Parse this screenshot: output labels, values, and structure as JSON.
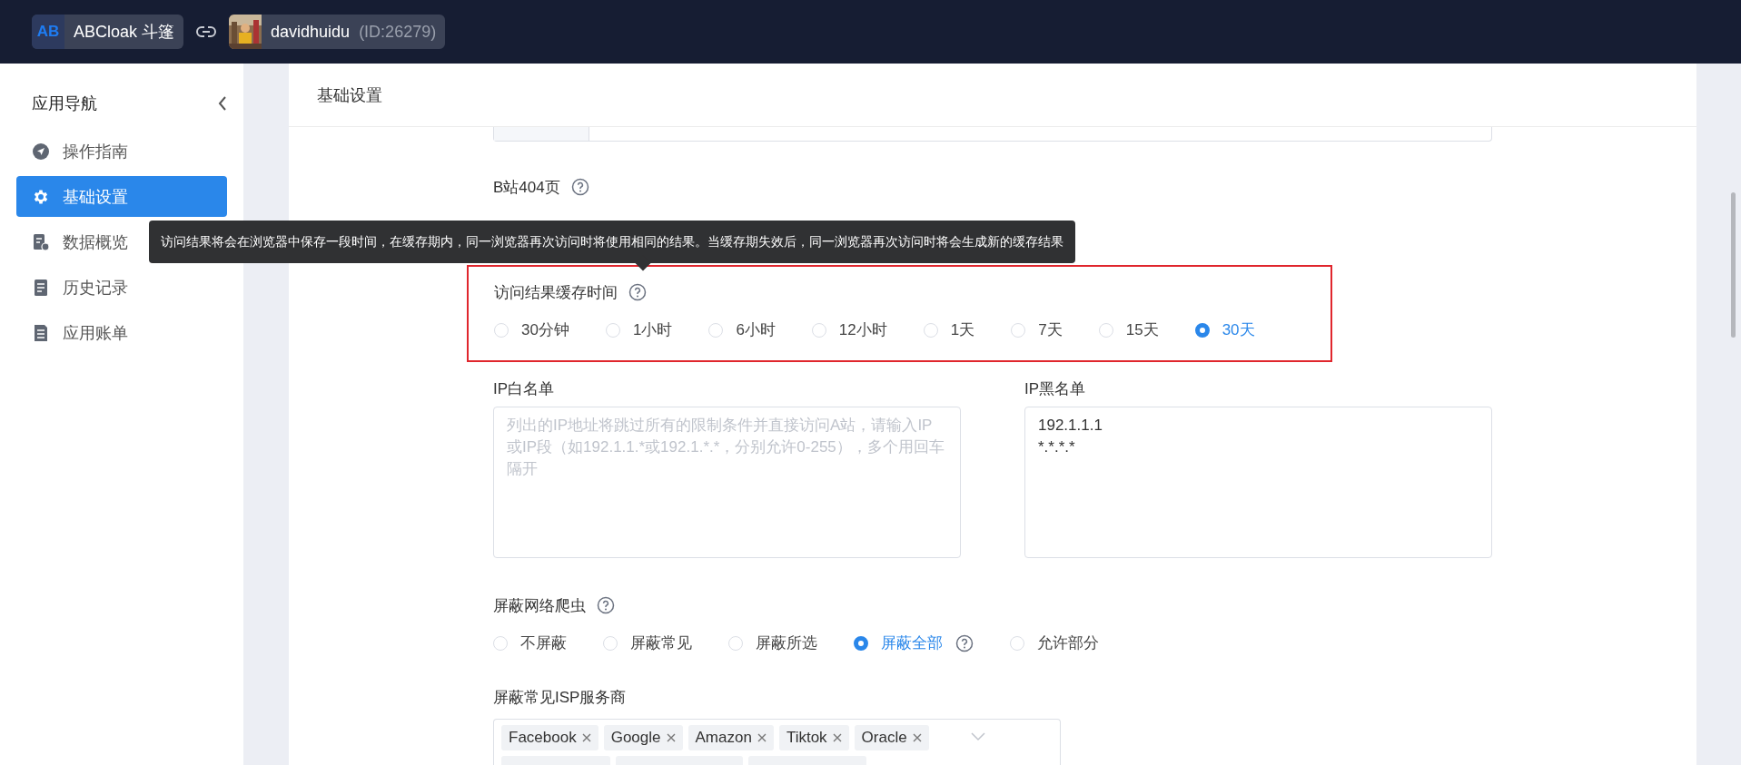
{
  "topbar": {
    "app": {
      "logo": "AB",
      "name": "ABCloak 斗篷"
    },
    "account": {
      "name": "davidhuidu",
      "id": "(ID:26279)"
    }
  },
  "sidebar": {
    "title": "应用导航",
    "items": [
      {
        "label": "操作指南",
        "kind": "guide",
        "selected": false
      },
      {
        "label": "基础设置",
        "kind": "settings",
        "selected": true
      },
      {
        "label": "数据概览",
        "kind": "stats",
        "selected": false
      },
      {
        "label": "历史记录",
        "kind": "history",
        "selected": false
      },
      {
        "label": "应用账单",
        "kind": "bill",
        "selected": false
      }
    ]
  },
  "page": {
    "title": "基础设置"
  },
  "sections": [
    {
      "kind": "label",
      "label": "B站404页",
      "help": true,
      "highlighted": false
    },
    {
      "kind": "radio",
      "label": "访问结果缓存时间",
      "help": true,
      "highlighted": true,
      "tooltip": "访问结果将会在浏览器中保存一段时间，在缓存期内，同一浏览器再次访问时将使用相同的结果。当缓存期失效后，同一浏览器再次访问时将会生成新的缓存结果",
      "options": [
        {
          "label": "30分钟",
          "selected": false
        },
        {
          "label": "1小时",
          "selected": false
        },
        {
          "label": "6小时",
          "selected": false
        },
        {
          "label": "12小时",
          "selected": false
        },
        {
          "label": "1天",
          "selected": false
        },
        {
          "label": "7天",
          "selected": false
        },
        {
          "label": "15天",
          "selected": false
        },
        {
          "label": "30天",
          "selected": true
        }
      ]
    },
    {
      "kind": "textareas",
      "fields": [
        {
          "label": "IP白名单",
          "placeholder": "列出的IP地址将跳过所有的限制条件并直接访问A站，请输入IP或IP段（如192.1.1.*或192.1.*.*，分别允许0-255），多个用回车隔开"
        },
        {
          "label": "IP黑名单",
          "value": "192.1.1.1\n*.*.*.*"
        }
      ]
    },
    {
      "kind": "radio",
      "label": "屏蔽网络爬虫",
      "help": true,
      "highlighted": false,
      "options": [
        {
          "label": "不屏蔽",
          "selected": false
        },
        {
          "label": "屏蔽常见",
          "selected": false
        },
        {
          "label": "屏蔽所选",
          "selected": false
        },
        {
          "label": "屏蔽全部",
          "selected": true,
          "help": true
        },
        {
          "label": "允许部分",
          "selected": false
        }
      ]
    },
    {
      "kind": "tags",
      "label": "屏蔽常见ISP服务商",
      "help": false,
      "highlighted": false,
      "tags": [
        "Facebook",
        "Google",
        "Amazon",
        "Tiktok",
        "Oracle"
      ]
    }
  ]
}
